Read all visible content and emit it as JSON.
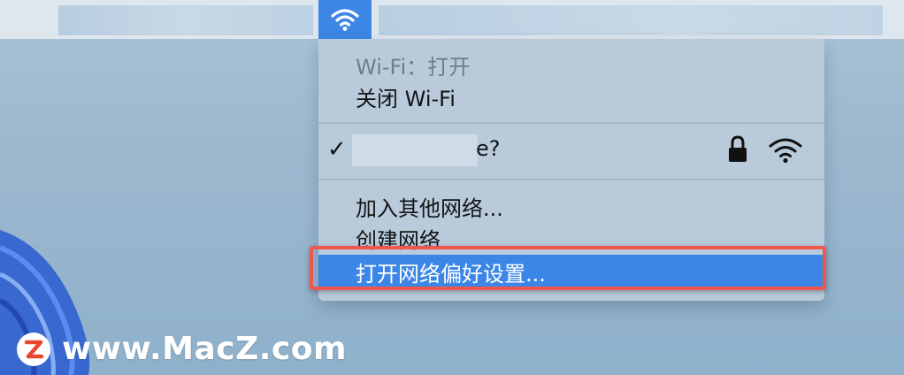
{
  "menubar": {
    "wifi_icon": "wifi-icon",
    "tray_color": "#3d86e6"
  },
  "wifi_menu": {
    "status_label": "Wi-Fi：打开",
    "toggle_label": "关闭 Wi-Fi",
    "current_network": {
      "name_visible_suffix": "e?",
      "connected": true,
      "secured": true,
      "lock_icon": "lock-icon",
      "signal_icon": "wifi-signal-icon"
    },
    "join_other_label": "加入其他网络...",
    "create_network_label": "创建网络",
    "open_prefs_label": "打开网络偏好设置..."
  },
  "watermark": {
    "logo_letter": "Z",
    "text": "www.MacZ.com"
  },
  "colors": {
    "highlight": "#3b86e6",
    "annotation_border": "#f0564e",
    "menu_bg": "#b9cbdb"
  }
}
